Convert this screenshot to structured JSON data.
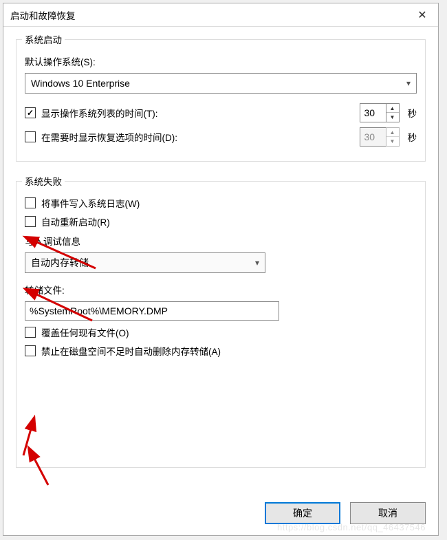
{
  "title": "启动和故障恢复",
  "close_icon": "✕",
  "group_startup": {
    "title": "系统启动",
    "default_os_label": "默认操作系统(S):",
    "default_os_value": "Windows 10 Enterprise",
    "show_os_list": {
      "checked": true,
      "label": "显示操作系统列表的时间(T):",
      "value": "30",
      "unit": "秒"
    },
    "show_recovery": {
      "checked": false,
      "label": "在需要时显示恢复选项的时间(D):",
      "value": "30",
      "unit": "秒"
    }
  },
  "group_failure": {
    "title": "系统失败",
    "write_log": {
      "checked": false,
      "label": "将事件写入系统日志(W)"
    },
    "auto_restart": {
      "checked": false,
      "label": "自动重新启动(R)"
    },
    "debug_info_label": "写入调试信息",
    "debug_info_value": "自动内存转储",
    "dump_file_label": "转储文件:",
    "dump_file_value": "%SystemRoot%\\MEMORY.DMP",
    "overwrite": {
      "checked": false,
      "label": "覆盖任何现有文件(O)"
    },
    "no_auto_delete": {
      "checked": false,
      "label": "禁止在磁盘空间不足时自动删除内存转储(A)"
    }
  },
  "buttons": {
    "ok": "确定",
    "cancel": "取消"
  },
  "watermark": "https://blog.csdn.net/qq_46437546"
}
